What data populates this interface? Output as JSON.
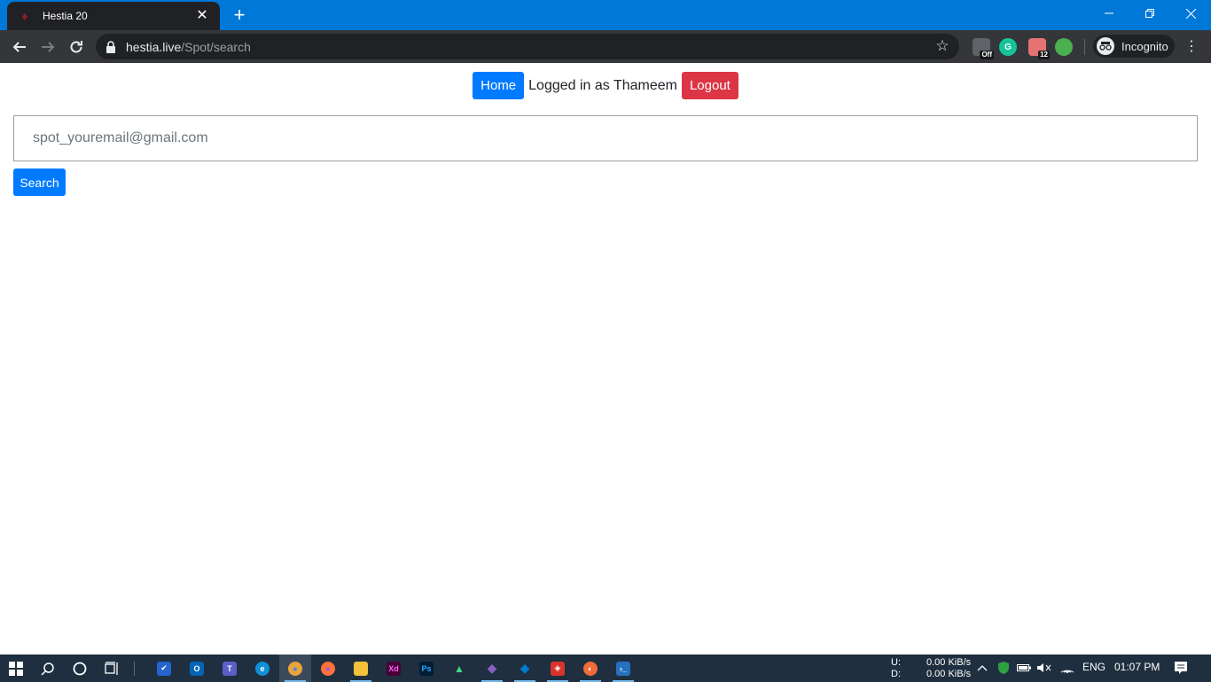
{
  "browser": {
    "tab_title": "Hestia 20",
    "tab_close": "✕",
    "new_tab": "+",
    "window_controls": {
      "minimize": "—",
      "restore": "❐",
      "close": "✕"
    },
    "nav": {
      "back": "←",
      "forward": "→",
      "reload": "⟳"
    },
    "url_host": "hestia.live",
    "url_path": "/Spot/search",
    "bookmark_star": "☆",
    "extensions": [
      {
        "name": "off-extension",
        "badge": "Off",
        "color": "#5f6368"
      },
      {
        "name": "grammarly",
        "label": "G",
        "color": "#15c39a"
      },
      {
        "name": "extension-12",
        "badge": "12",
        "color": "#e57373"
      },
      {
        "name": "color-extension",
        "label": "",
        "color": "#4caf50"
      }
    ],
    "incognito_label": "Incognito",
    "menu": "⋮"
  },
  "page": {
    "home_label": "Home",
    "logged_in_text": "Logged in as Thameem",
    "logout_label": "Logout",
    "search_placeholder": "spot_youremail@gmail.com",
    "search_value": "",
    "search_button": "Search"
  },
  "taskbar": {
    "apps": [
      {
        "name": "start-button",
        "glyph": "⊞",
        "color": "#1f2f3f"
      },
      {
        "name": "search",
        "glyph": "⌕",
        "color": "#1f2f3f"
      },
      {
        "name": "cortana",
        "glyph": "○",
        "color": "#1f2f3f"
      },
      {
        "name": "task-view",
        "glyph": "▤",
        "color": "#1f2f3f"
      },
      {
        "name": "todo",
        "glyph": "✔",
        "color": "#2564cf"
      },
      {
        "name": "outlook",
        "glyph": "O",
        "color": "#0364b8"
      },
      {
        "name": "teams",
        "glyph": "T",
        "color": "#5b5fc7"
      },
      {
        "name": "edge",
        "glyph": "e",
        "color": "#0f8fd8"
      },
      {
        "name": "chrome",
        "glyph": "●",
        "color": "#e8a33d"
      },
      {
        "name": "firefox",
        "glyph": "●",
        "color": "#ff7139"
      },
      {
        "name": "file-explorer",
        "glyph": "▬",
        "color": "#f3c13a"
      },
      {
        "name": "adobe-xd",
        "glyph": "Xd",
        "color": "#470137"
      },
      {
        "name": "photoshop",
        "glyph": "Ps",
        "color": "#001e36"
      },
      {
        "name": "android-studio",
        "glyph": "▲",
        "color": "#3ddc84"
      },
      {
        "name": "visual-studio",
        "glyph": "◆",
        "color": "#865fc5"
      },
      {
        "name": "vs-code",
        "glyph": "◆",
        "color": "#007acc"
      },
      {
        "name": "app-red",
        "glyph": "◈",
        "color": "#d9342b"
      },
      {
        "name": "app-orange",
        "glyph": "◐",
        "color": "#f26b3a"
      },
      {
        "name": "powershell",
        "glyph": "›_",
        "color": "#2671be"
      }
    ],
    "net_u_label": "U:",
    "net_d_label": "D:",
    "net_u_value": "0.00 KiB/s",
    "net_d_value": "0.00 KiB/s",
    "tray_chevron": "^",
    "language": "ENG",
    "time": "01:07 PM",
    "notification_icon": "▤"
  }
}
